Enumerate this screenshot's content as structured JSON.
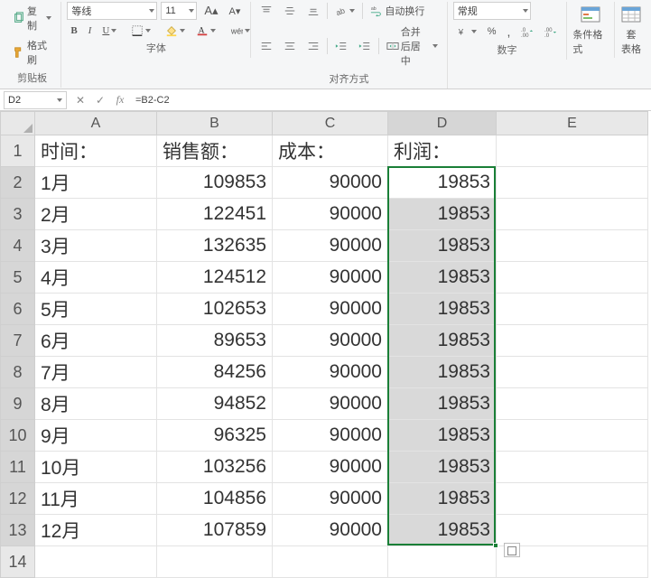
{
  "ribbon": {
    "clipboard": {
      "copy": "复制",
      "format_painter": "格式刷",
      "label": "剪贴板"
    },
    "font": {
      "name": "等线",
      "size": "11",
      "bold": "B",
      "italic": "I",
      "underline": "U",
      "label": "字体"
    },
    "align": {
      "wrap": "自动换行",
      "merge": "合并后居中",
      "label": "对齐方式"
    },
    "number": {
      "format": "常规",
      "label": "数字"
    },
    "styles": {
      "cond": "条件格式",
      "table": "套\n表格"
    }
  },
  "formula_bar": {
    "name_box": "D2",
    "formula": "=B2-C2"
  },
  "columns": [
    "A",
    "B",
    "C",
    "D",
    "E"
  ],
  "headers": {
    "A": "时间：",
    "B": "销售额：",
    "C": "成本：",
    "D": "利润："
  },
  "rows": [
    {
      "r": 2,
      "A": "1月",
      "B": 109853,
      "C": 90000,
      "D": 19853
    },
    {
      "r": 3,
      "A": "2月",
      "B": 122451,
      "C": 90000,
      "D": 19853
    },
    {
      "r": 4,
      "A": "3月",
      "B": 132635,
      "C": 90000,
      "D": 19853
    },
    {
      "r": 5,
      "A": "4月",
      "B": 124512,
      "C": 90000,
      "D": 19853
    },
    {
      "r": 6,
      "A": "5月",
      "B": 102653,
      "C": 90000,
      "D": 19853
    },
    {
      "r": 7,
      "A": "6月",
      "B": 89653,
      "C": 90000,
      "D": 19853
    },
    {
      "r": 8,
      "A": "7月",
      "B": 84256,
      "C": 90000,
      "D": 19853
    },
    {
      "r": 9,
      "A": "8月",
      "B": 94852,
      "C": 90000,
      "D": 19853
    },
    {
      "r": 10,
      "A": "9月",
      "B": 96325,
      "C": 90000,
      "D": 19853
    },
    {
      "r": 11,
      "A": "10月",
      "B": 103256,
      "C": 90000,
      "D": 19853
    },
    {
      "r": 12,
      "A": "11月",
      "B": 104856,
      "C": 90000,
      "D": 19853
    },
    {
      "r": 13,
      "A": "12月",
      "B": 107859,
      "C": 90000,
      "D": 19853
    }
  ],
  "selection": {
    "col": "D",
    "r1": 2,
    "r2": 13,
    "active_r": 2
  }
}
